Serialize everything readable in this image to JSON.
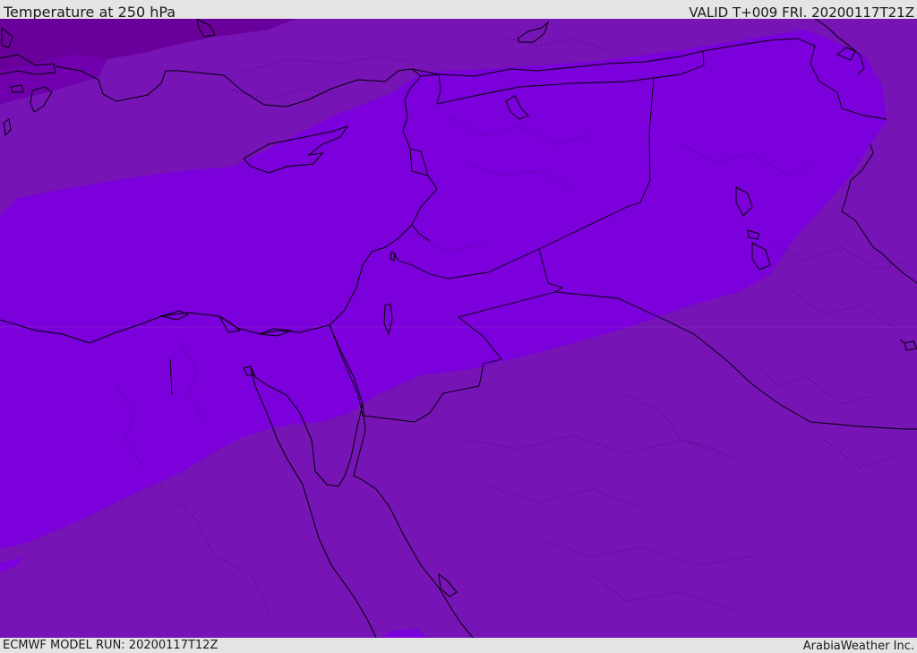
{
  "header": {
    "title": "Temperature at 250 hPa",
    "valid_time": "VALID T+009 FRI. 20200117T21Z"
  },
  "footer": {
    "model_run": "ECMWF MODEL RUN: 20200117T12Z",
    "credit": "ArabiaWeather Inc."
  },
  "map": {
    "field": "temperature",
    "pressure_level": "250 hPa",
    "colors": {
      "warmer_band": "#7614b6",
      "colder_band": "#7b00db",
      "coldest_patch": "#6a009c",
      "sea_tint": "#7800c4",
      "coastline": "#000000",
      "border": "#000000",
      "admin_boundary": "#3a0060"
    },
    "lines": [
      "coastline",
      "country-border",
      "admin-boundary"
    ]
  }
}
